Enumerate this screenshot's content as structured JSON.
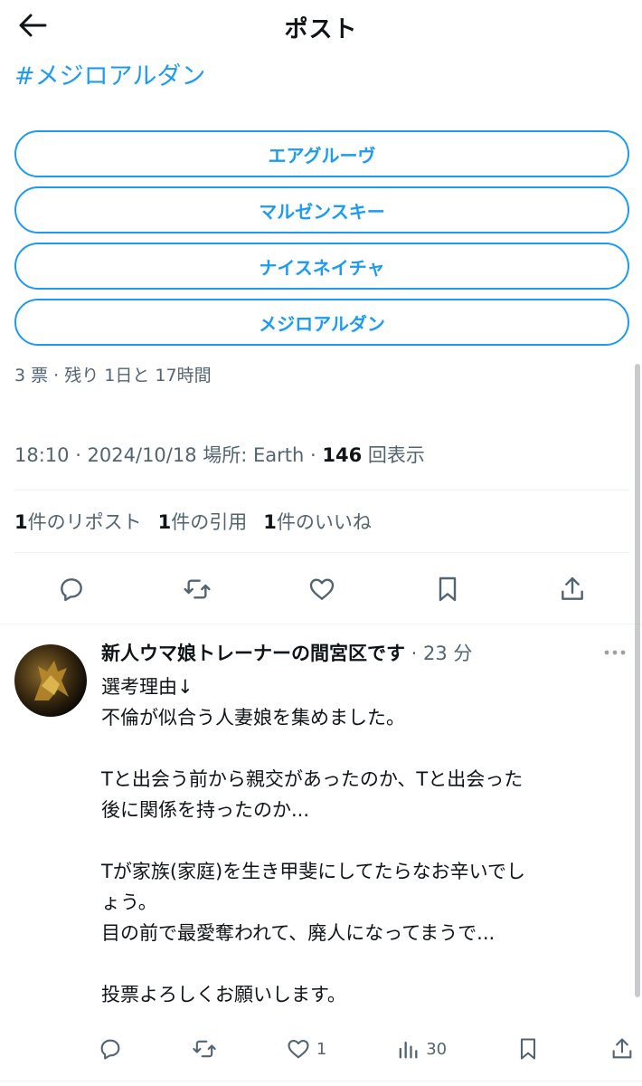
{
  "header": {
    "title": "ポスト",
    "back_icon": "arrow-left-icon"
  },
  "hashtag": "#メジロアルダン",
  "poll": {
    "options": [
      "エアグルーヴ",
      "マルゼンスキー",
      "ナイスネイチャ",
      "メジロアルダン"
    ],
    "meta": "3 票 · 残り 1日と 17時間"
  },
  "post_meta": {
    "time": "18:10 · 2024/10/18  場所: Earth · ",
    "views_count": "146",
    "views_label": " 回表示"
  },
  "stats": {
    "reposts_count": "1",
    "reposts_label": "件のリポスト",
    "quotes_count": "1",
    "quotes_label": "件の引用",
    "likes_count": "1",
    "likes_label": "件のいいね"
  },
  "reply": {
    "name": "新人ウマ娘トレーナーの間宮区です",
    "time": " · 23 分",
    "lines": [
      "選考理由↓",
      "不倫が似合う人妻娘を集めました。",
      "",
      "Tと出会う前から親交があったのか、Tと出会った",
      "後に関係を持ったのか...",
      "",
      "Tが家族(家庭)を生き甲斐にしてたらなお辛いでし",
      "ょう。",
      "目の前で最愛奪われて、廃人になってまうで...",
      "",
      "投票よろしくお願いします。"
    ],
    "likes": "1",
    "views": "30"
  },
  "colors": {
    "accent": "#1d9bf0",
    "text": "#0f1419",
    "muted": "#536471",
    "divider": "#eff3f4"
  }
}
